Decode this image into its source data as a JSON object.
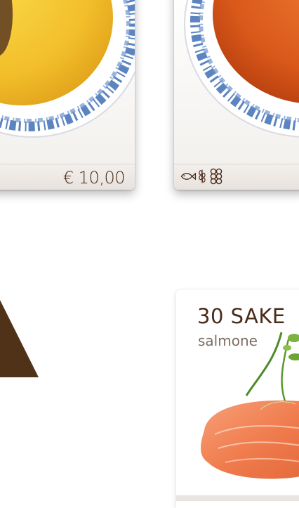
{
  "menu": {
    "left_card": {
      "price": "€ 10,00",
      "image": "soup-bowl-image"
    },
    "right_card": {
      "allergen_icons": [
        "fish-icon",
        "wheat-icon",
        "soy-icon"
      ],
      "image": "sauce-bowl-image"
    },
    "bottom_card": {
      "title": "30 SAKE",
      "subtitle": "salmone",
      "image": "salmon-sashimi-image"
    }
  },
  "colors": {
    "brand_brown": "#4a2c1a",
    "triangle": "#4f3218",
    "bowl_blue": "#3f6fb5",
    "soup_yellow": "#f2c02e",
    "sauce_orange": "#e0631e",
    "salmon": "#f08a5d"
  }
}
